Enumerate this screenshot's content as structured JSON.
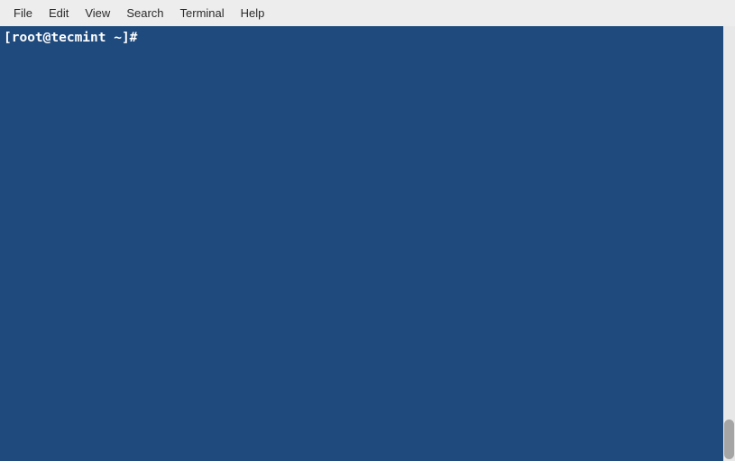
{
  "menubar": {
    "items": [
      {
        "label": "File"
      },
      {
        "label": "Edit"
      },
      {
        "label": "View"
      },
      {
        "label": "Search"
      },
      {
        "label": "Terminal"
      },
      {
        "label": "Help"
      }
    ]
  },
  "terminal": {
    "prompt": "[root@tecmint ~]# "
  }
}
